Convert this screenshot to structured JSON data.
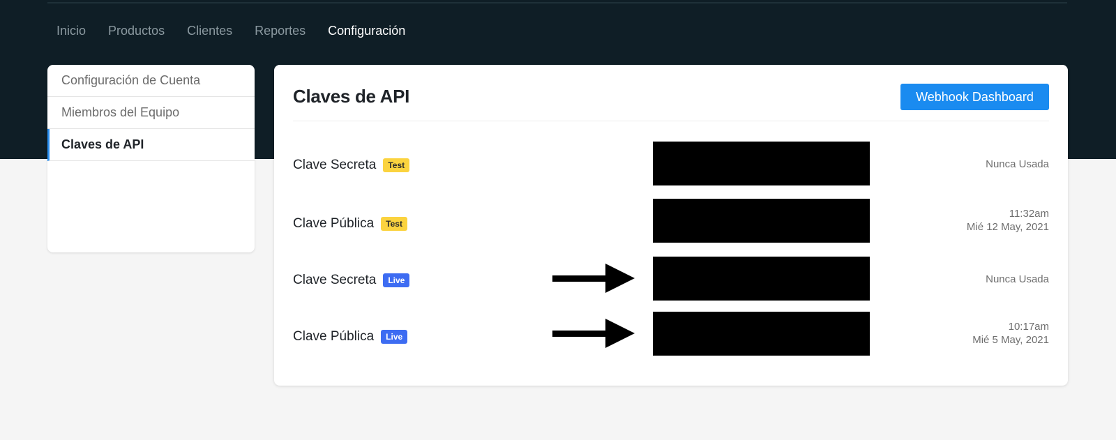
{
  "topnav": {
    "items": [
      {
        "label": "Inicio"
      },
      {
        "label": "Productos"
      },
      {
        "label": "Clientes"
      },
      {
        "label": "Reportes"
      },
      {
        "label": "Configuración",
        "active": true
      }
    ]
  },
  "sidebar": {
    "items": [
      {
        "label": "Configuración de Cuenta"
      },
      {
        "label": "Miembros del Equipo"
      },
      {
        "label": "Claves de API",
        "active": true
      }
    ]
  },
  "panel": {
    "title": "Claves de API",
    "webhook_button": "Webhook Dashboard"
  },
  "keys": [
    {
      "label": "Clave Secreta",
      "badge": "Test",
      "last_used_line1": "Nunca Usada",
      "last_used_line2": ""
    },
    {
      "label": "Clave Pública",
      "badge": "Test",
      "last_used_line1": "11:32am",
      "last_used_line2": "Mié 12 May, 2021"
    },
    {
      "label": "Clave Secreta",
      "badge": "Live",
      "last_used_line1": "Nunca Usada",
      "last_used_line2": ""
    },
    {
      "label": "Clave Pública",
      "badge": "Live",
      "last_used_line1": "10:17am",
      "last_used_line2": "Mié 5 May, 2021"
    }
  ],
  "colors": {
    "header_bg": "#0f1e26",
    "accent": "#1a8bf0",
    "badge_test": "#fbd33f",
    "badge_live": "#3d6cf2",
    "redaction": "#000000"
  },
  "icons": {
    "annotation_arrow": "right-arrow-icon"
  }
}
